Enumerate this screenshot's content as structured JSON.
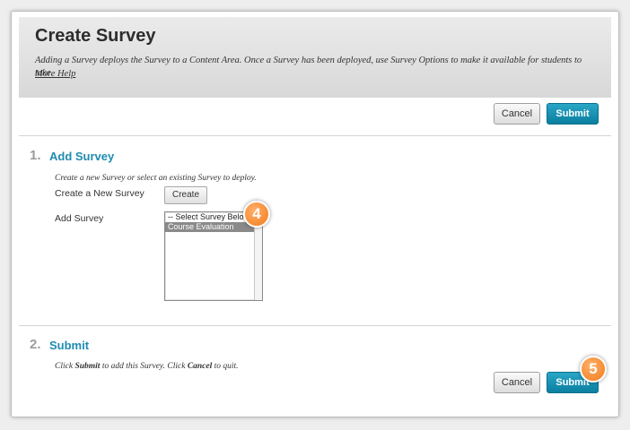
{
  "page": {
    "title": "Create Survey",
    "description": "Adding a Survey deploys the Survey to a Content Area. Once a Survey has been deployed, use Survey Options to make it available for students to take.",
    "help_link": "More Help"
  },
  "top_actions": {
    "cancel": "Cancel",
    "submit": "Submit"
  },
  "section1": {
    "number": "1.",
    "title": "Add Survey",
    "instructions": "Create a new Survey or select an existing Survey to deploy.",
    "create_label": "Create a New Survey",
    "create_button": "Create",
    "add_label": "Add Survey",
    "options": [
      "-- Select Survey Below --",
      "Course Evaluation"
    ]
  },
  "section2": {
    "number": "2.",
    "title": "Submit",
    "instr_a": "Click ",
    "instr_b": "Submit",
    "instr_c": " to add this Survey. Click ",
    "instr_d": "Cancel",
    "instr_e": " to quit."
  },
  "bottom_actions": {
    "cancel": "Cancel",
    "submit": "Submit"
  },
  "callouts": {
    "first": "4",
    "second": "5"
  },
  "colors": {
    "accent": "#0b7fa0",
    "heading_link": "#1e8bb0",
    "callout": "#f27a18"
  }
}
